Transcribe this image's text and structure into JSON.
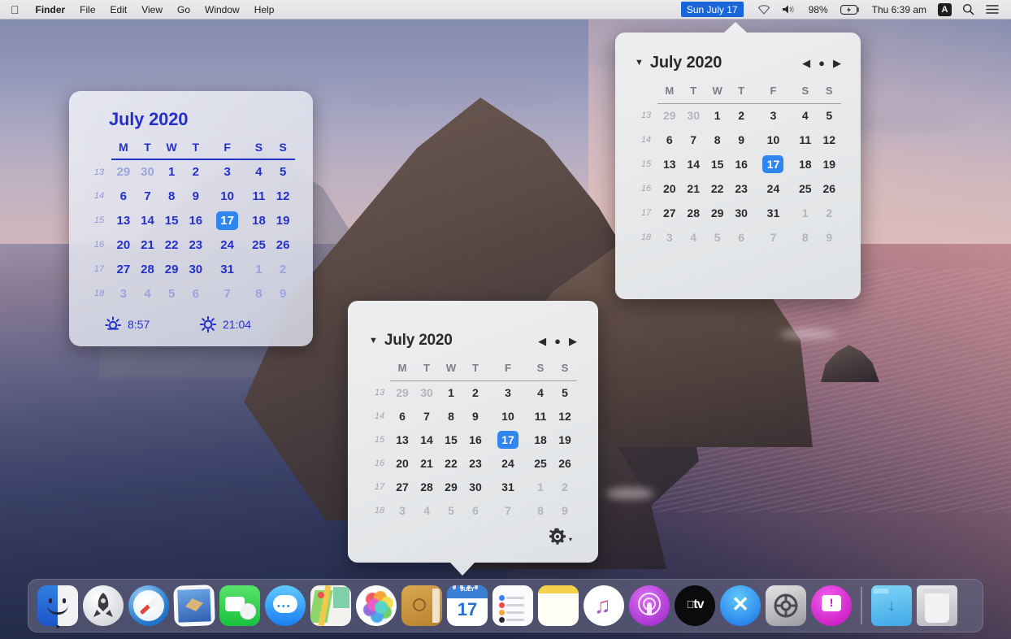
{
  "menubar": {
    "apple_icon": "apple-icon",
    "items": [
      "Finder",
      "File",
      "Edit",
      "View",
      "Go",
      "Window",
      "Help"
    ],
    "date_highlight": "Sun July 17",
    "wifi_icon": "wifi-icon",
    "volume_icon": "volume-icon",
    "battery_percent": "98%",
    "battery_icon": "battery-charging-icon",
    "clock": "Thu 6:39 am",
    "input_flag": "A",
    "search_icon": "search-icon",
    "control_center_icon": "control-center-icon"
  },
  "widget": {
    "title": "July 2020",
    "weekday_headers": [
      "M",
      "T",
      "W",
      "T",
      "F",
      "S",
      "S"
    ],
    "week_numbers": [
      "13",
      "14",
      "15",
      "16",
      "17",
      "18"
    ],
    "weeks": [
      [
        {
          "d": "29",
          "t": "out"
        },
        {
          "d": "30",
          "t": "out"
        },
        {
          "d": "1",
          "t": "in"
        },
        {
          "d": "2",
          "t": "in"
        },
        {
          "d": "3",
          "t": "in"
        },
        {
          "d": "4",
          "t": "in"
        },
        {
          "d": "5",
          "t": "in"
        }
      ],
      [
        {
          "d": "6",
          "t": "in"
        },
        {
          "d": "7",
          "t": "in"
        },
        {
          "d": "8",
          "t": "in"
        },
        {
          "d": "9",
          "t": "in"
        },
        {
          "d": "10",
          "t": "in"
        },
        {
          "d": "11",
          "t": "in"
        },
        {
          "d": "12",
          "t": "in"
        }
      ],
      [
        {
          "d": "13",
          "t": "in"
        },
        {
          "d": "14",
          "t": "in"
        },
        {
          "d": "15",
          "t": "in"
        },
        {
          "d": "16",
          "t": "in"
        },
        {
          "d": "17",
          "t": "sel"
        },
        {
          "d": "18",
          "t": "in"
        },
        {
          "d": "19",
          "t": "in"
        }
      ],
      [
        {
          "d": "20",
          "t": "in"
        },
        {
          "d": "21",
          "t": "in"
        },
        {
          "d": "22",
          "t": "in"
        },
        {
          "d": "23",
          "t": "in"
        },
        {
          "d": "24",
          "t": "in"
        },
        {
          "d": "25",
          "t": "in"
        },
        {
          "d": "26",
          "t": "in"
        }
      ],
      [
        {
          "d": "27",
          "t": "in"
        },
        {
          "d": "28",
          "t": "in"
        },
        {
          "d": "29",
          "t": "in"
        },
        {
          "d": "30",
          "t": "in"
        },
        {
          "d": "31",
          "t": "in"
        },
        {
          "d": "1",
          "t": "next"
        },
        {
          "d": "2",
          "t": "next"
        }
      ],
      [
        {
          "d": "3",
          "t": "next"
        },
        {
          "d": "4",
          "t": "next"
        },
        {
          "d": "5",
          "t": "next"
        },
        {
          "d": "6",
          "t": "next"
        },
        {
          "d": "7",
          "t": "next"
        },
        {
          "d": "8",
          "t": "next"
        },
        {
          "d": "9",
          "t": "next"
        }
      ]
    ],
    "sunrise_icon": "sunrise-icon",
    "sunrise_time": "8:57",
    "sunset_icon": "sunset-icon",
    "sunset_time": "21:04",
    "accent_color": "#2431c8",
    "selected_color": "#2f86ef"
  },
  "popover_top": {
    "caret_icon": "chevron-down-icon",
    "title": "July 2020",
    "nav_prev_icon": "prev-month-icon",
    "nav_today_icon": "today-dot-icon",
    "nav_next_icon": "next-month-icon",
    "nav_prev": "◀",
    "nav_today": "●",
    "nav_next": "▶",
    "weekday_headers": [
      "M",
      "T",
      "W",
      "T",
      "F",
      "S",
      "S"
    ],
    "week_numbers": [
      "13",
      "14",
      "15",
      "16",
      "17",
      "18"
    ],
    "weeks": [
      [
        {
          "d": "29",
          "t": "out"
        },
        {
          "d": "30",
          "t": "out"
        },
        {
          "d": "1",
          "t": "in"
        },
        {
          "d": "2",
          "t": "in"
        },
        {
          "d": "3",
          "t": "in"
        },
        {
          "d": "4",
          "t": "in"
        },
        {
          "d": "5",
          "t": "in"
        }
      ],
      [
        {
          "d": "6",
          "t": "in"
        },
        {
          "d": "7",
          "t": "in"
        },
        {
          "d": "8",
          "t": "in"
        },
        {
          "d": "9",
          "t": "in"
        },
        {
          "d": "10",
          "t": "in"
        },
        {
          "d": "11",
          "t": "in"
        },
        {
          "d": "12",
          "t": "in"
        }
      ],
      [
        {
          "d": "13",
          "t": "in"
        },
        {
          "d": "14",
          "t": "in"
        },
        {
          "d": "15",
          "t": "in"
        },
        {
          "d": "16",
          "t": "in"
        },
        {
          "d": "17",
          "t": "sel"
        },
        {
          "d": "18",
          "t": "in"
        },
        {
          "d": "19",
          "t": "in"
        }
      ],
      [
        {
          "d": "20",
          "t": "in"
        },
        {
          "d": "21",
          "t": "in"
        },
        {
          "d": "22",
          "t": "in"
        },
        {
          "d": "23",
          "t": "in"
        },
        {
          "d": "24",
          "t": "in"
        },
        {
          "d": "25",
          "t": "in"
        },
        {
          "d": "26",
          "t": "in"
        }
      ],
      [
        {
          "d": "27",
          "t": "in"
        },
        {
          "d": "28",
          "t": "in"
        },
        {
          "d": "29",
          "t": "in"
        },
        {
          "d": "30",
          "t": "in"
        },
        {
          "d": "31",
          "t": "in"
        },
        {
          "d": "1",
          "t": "out"
        },
        {
          "d": "2",
          "t": "out"
        }
      ],
      [
        {
          "d": "3",
          "t": "out"
        },
        {
          "d": "4",
          "t": "out"
        },
        {
          "d": "5",
          "t": "out"
        },
        {
          "d": "6",
          "t": "out"
        },
        {
          "d": "7",
          "t": "out"
        },
        {
          "d": "8",
          "t": "out"
        },
        {
          "d": "9",
          "t": "out"
        }
      ]
    ]
  },
  "popover_bottom": {
    "caret_icon": "chevron-down-icon",
    "title": "July 2020",
    "nav_prev": "◀",
    "nav_today": "●",
    "nav_next": "▶",
    "weekday_headers": [
      "M",
      "T",
      "W",
      "T",
      "F",
      "S",
      "S"
    ],
    "week_numbers": [
      "13",
      "14",
      "15",
      "16",
      "17",
      "18"
    ],
    "weeks": [
      [
        {
          "d": "29",
          "t": "out"
        },
        {
          "d": "30",
          "t": "out"
        },
        {
          "d": "1",
          "t": "in"
        },
        {
          "d": "2",
          "t": "in"
        },
        {
          "d": "3",
          "t": "in"
        },
        {
          "d": "4",
          "t": "in"
        },
        {
          "d": "5",
          "t": "in"
        }
      ],
      [
        {
          "d": "6",
          "t": "in"
        },
        {
          "d": "7",
          "t": "in"
        },
        {
          "d": "8",
          "t": "in"
        },
        {
          "d": "9",
          "t": "in"
        },
        {
          "d": "10",
          "t": "in"
        },
        {
          "d": "11",
          "t": "in"
        },
        {
          "d": "12",
          "t": "in"
        }
      ],
      [
        {
          "d": "13",
          "t": "in"
        },
        {
          "d": "14",
          "t": "in"
        },
        {
          "d": "15",
          "t": "in"
        },
        {
          "d": "16",
          "t": "in"
        },
        {
          "d": "17",
          "t": "sel"
        },
        {
          "d": "18",
          "t": "in"
        },
        {
          "d": "19",
          "t": "in"
        }
      ],
      [
        {
          "d": "20",
          "t": "in"
        },
        {
          "d": "21",
          "t": "in"
        },
        {
          "d": "22",
          "t": "in"
        },
        {
          "d": "23",
          "t": "in"
        },
        {
          "d": "24",
          "t": "in"
        },
        {
          "d": "25",
          "t": "in"
        },
        {
          "d": "26",
          "t": "in"
        }
      ],
      [
        {
          "d": "27",
          "t": "in"
        },
        {
          "d": "28",
          "t": "in"
        },
        {
          "d": "29",
          "t": "in"
        },
        {
          "d": "30",
          "t": "in"
        },
        {
          "d": "31",
          "t": "in"
        },
        {
          "d": "1",
          "t": "out"
        },
        {
          "d": "2",
          "t": "out"
        }
      ],
      [
        {
          "d": "3",
          "t": "out"
        },
        {
          "d": "4",
          "t": "out"
        },
        {
          "d": "5",
          "t": "out"
        },
        {
          "d": "6",
          "t": "out"
        },
        {
          "d": "7",
          "t": "out"
        },
        {
          "d": "8",
          "t": "out"
        },
        {
          "d": "9",
          "t": "out"
        }
      ]
    ],
    "settings_icon": "gear-icon",
    "settings_arrow": "▾"
  },
  "dock": {
    "items": [
      {
        "name": "finder",
        "label": "Finder",
        "running": true
      },
      {
        "name": "launchpad",
        "label": "Launchpad",
        "running": false
      },
      {
        "name": "safari",
        "label": "Safari",
        "running": false
      },
      {
        "name": "mail",
        "label": "Mail",
        "running": false
      },
      {
        "name": "facetime",
        "label": "FaceTime",
        "running": false
      },
      {
        "name": "messages",
        "label": "Messages",
        "running": false
      },
      {
        "name": "maps",
        "label": "Maps",
        "running": false
      },
      {
        "name": "photos",
        "label": "Photos",
        "running": false
      },
      {
        "name": "contacts",
        "label": "Contacts",
        "running": false
      },
      {
        "name": "calendar",
        "label": "Calendar",
        "running": false
      },
      {
        "name": "reminders",
        "label": "Reminders",
        "running": false
      },
      {
        "name": "notes",
        "label": "Notes",
        "running": false
      },
      {
        "name": "music",
        "label": "Music",
        "running": false
      },
      {
        "name": "podcasts",
        "label": "Podcasts",
        "running": false
      },
      {
        "name": "tv",
        "label": "TV",
        "running": false
      },
      {
        "name": "app-store",
        "label": "App Store",
        "running": false
      },
      {
        "name": "system-preferences",
        "label": "System Preferences",
        "running": false
      },
      {
        "name": "alert-app",
        "label": "Alert",
        "running": false
      }
    ],
    "calendar_icon_month": "JULY",
    "calendar_icon_day": "17",
    "tv_label": "tv",
    "downloads_label": "Downloads",
    "trash_label": "Trash"
  }
}
